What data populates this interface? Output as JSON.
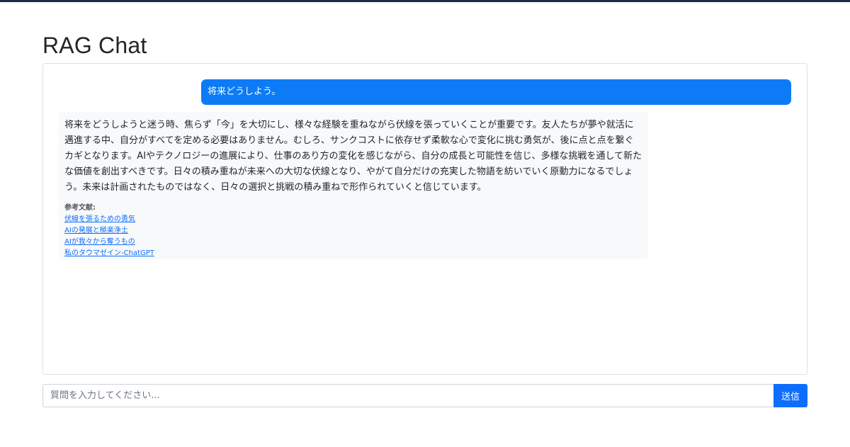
{
  "page": {
    "title": "RAG Chat"
  },
  "chat": {
    "messages": [
      {
        "role": "user",
        "text": "将来どうしよう。"
      },
      {
        "role": "assistant",
        "text": "将来をどうしようと迷う時、焦らず「今」を大切にし、様々な経験を重ねながら伏線を張っていくことが重要です。友人たちが夢や就活に邁進する中、自分がすべてを定める必要はありません。むしろ、サンクコストに依存せず柔軟な心で変化に挑む勇気が、後に点と点を繋ぐカギとなります。AIやテクノロジーの進展により、仕事のあり方の変化を感じながら、自分の成長と可能性を信じ、多様な挑戦を通して新たな価値を創出すべきです。日々の積み重ねが未来への大切な伏線となり、やがて自分だけの充実した物語を紡いでいく原動力になるでしょう。未来は計画されたものではなく、日々の選択と挑戦の積み重ねで形作られていくと信じています。",
        "references_label": "参考文献:",
        "references": [
          "伏線を張るための勇気",
          "AIの発展と極楽浄土",
          "AIが我々から奪うもの",
          "私のタウマゼイン-ChatGPT"
        ]
      }
    ]
  },
  "input": {
    "placeholder": "質問を入力してください...",
    "value": "",
    "send_label": "送信"
  },
  "colors": {
    "topbar": "#1b2a45",
    "user_bubble": "#0d7bf5",
    "assistant_bubble": "#f8f9fa",
    "primary": "#0d6efd"
  }
}
